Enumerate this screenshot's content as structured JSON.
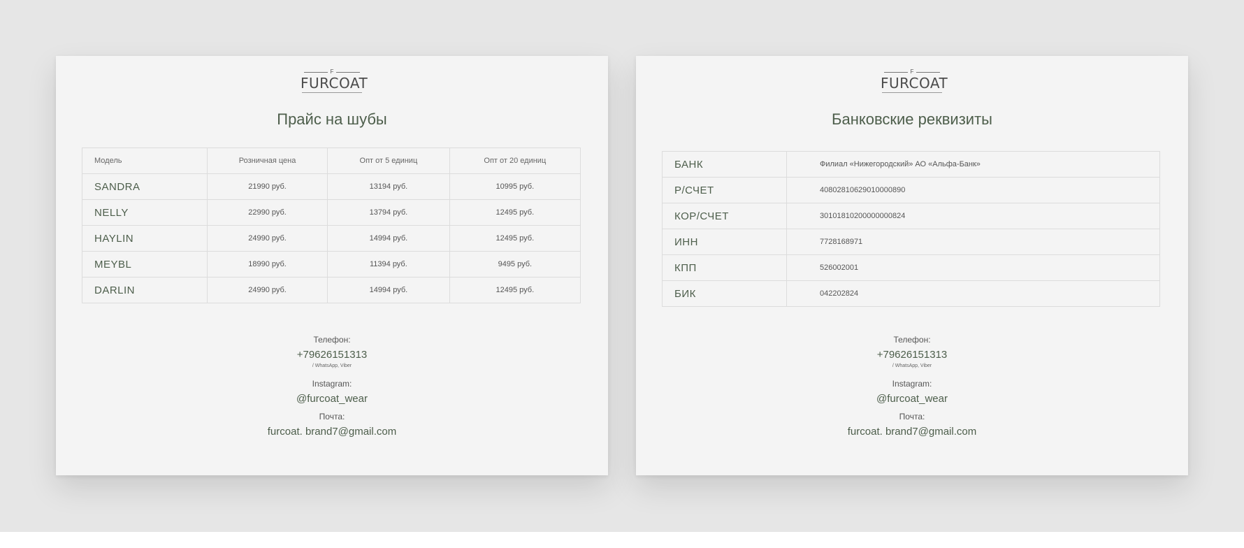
{
  "logo": {
    "mark": "F",
    "brand": "FURCOAT"
  },
  "price_card": {
    "title": "Прайс на шубы",
    "headers": [
      "Модель",
      "Розничная цена",
      "Опт от 5 единиц",
      "Опт от 20 единиц"
    ],
    "rows": [
      [
        "SANDRA",
        "21990 руб.",
        "13194 руб.",
        "10995 руб."
      ],
      [
        "NELLY",
        "22990 руб.",
        "13794 руб.",
        "12495 руб."
      ],
      [
        "HAYLIN",
        "24990 руб.",
        "14994 руб.",
        "12495 руб."
      ],
      [
        "MEYBL",
        "18990 руб.",
        "11394 руб.",
        "9495 руб."
      ],
      [
        "DARLIN",
        "24990 руб.",
        "14994 руб.",
        "12495 руб."
      ]
    ]
  },
  "bank_card": {
    "title": "Банковские реквизиты",
    "rows": [
      [
        "БАНК",
        "Филиал «Нижегородский» АО  «Альфа-Банк»"
      ],
      [
        "Р/СЧЕТ",
        "40802810629010000890"
      ],
      [
        "КОР/СЧЕТ",
        "30101810200000000824"
      ],
      [
        "ИНН",
        "7728168971"
      ],
      [
        "КПП",
        "526002001"
      ],
      [
        "БИК",
        "042202824"
      ]
    ]
  },
  "contacts": {
    "phone_label": "Телефон:",
    "phone": "+79626151313",
    "phone_note": "/ WhatsApp, Viber",
    "instagram_label": "Instagram:",
    "instagram": "@furcoat_wear",
    "email_label": "Почта:",
    "email": "furcoat. brand7@gmail.com"
  }
}
